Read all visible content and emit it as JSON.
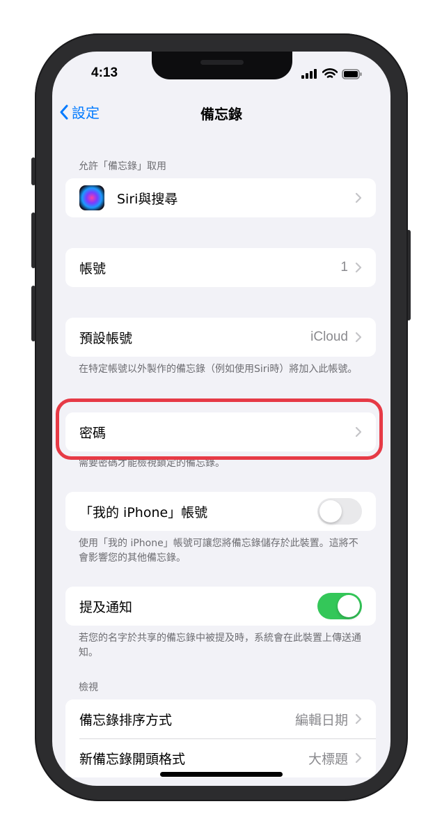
{
  "status_bar": {
    "time": "4:13"
  },
  "nav": {
    "back_label": "設定",
    "title": "備忘錄"
  },
  "sections": {
    "allow_header": "允許「備忘錄」取用",
    "siri_label": "Siri與搜尋",
    "accounts_label": "帳號",
    "accounts_value": "1",
    "default_account_label": "預設帳號",
    "default_account_value": "iCloud",
    "default_account_footer": "在特定帳號以外製作的備忘錄（例如使用Siri時）將加入此帳號。",
    "password_label": "密碼",
    "password_footer": "需要密碼才能檢視鎖定的備忘錄。",
    "on_my_iphone_label": "「我的 iPhone」帳號",
    "on_my_iphone_footer": "使用「我的 iPhone」帳號可讓您將備忘錄儲存於此裝置。這將不會影響您的其他備忘錄。",
    "mention_label": "提及通知",
    "mention_footer": "若您的名字於共享的備忘錄中被提及時，系統會在此裝置上傳送通知。",
    "view_header": "檢視",
    "sort_label": "備忘錄排序方式",
    "sort_value": "編輯日期",
    "new_note_label": "新備忘錄開頭格式",
    "new_note_value": "大標題"
  },
  "toggles": {
    "on_my_iphone": false,
    "mention_notifications": true
  },
  "colors": {
    "accent": "#007aff",
    "toggle_on": "#34c759",
    "highlight": "#e63a46"
  }
}
